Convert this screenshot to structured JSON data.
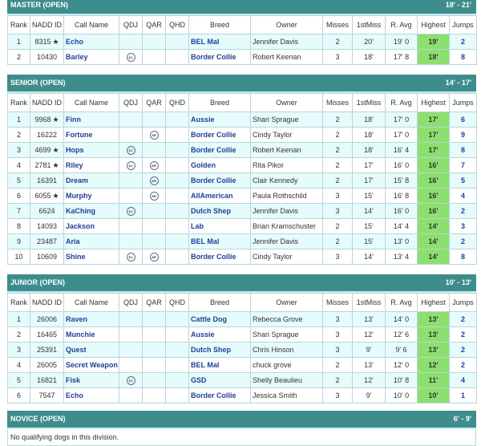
{
  "columns": [
    "Rank",
    "NADD ID",
    "Call Name",
    "QDJ",
    "QAR",
    "QHD",
    "Breed",
    "Owner",
    "Misses",
    "1stMiss",
    "R. Avg",
    "Highest",
    "Jumps"
  ],
  "badges": {
    "qdj": "DJ",
    "qar": "AR"
  },
  "sections": [
    {
      "title": "MASTER (OPEN)",
      "range": "18' - 21'",
      "rows": [
        {
          "rank": "1",
          "id": "8315",
          "star": true,
          "name": "Echo",
          "qdj": false,
          "qar": false,
          "breed": "BEL Mal",
          "owner": "Jennifer Davis",
          "misses": "2",
          "first": "20'",
          "avg": "19' 0",
          "high": "19'",
          "jumps": "2"
        },
        {
          "rank": "2",
          "id": "10430",
          "star": false,
          "name": "Barley",
          "qdj": true,
          "qar": false,
          "breed": "Border Collie",
          "owner": "Robert Keenan",
          "misses": "3",
          "first": "18'",
          "avg": "17' 8",
          "high": "18'",
          "jumps": "8"
        }
      ]
    },
    {
      "title": "SENIOR (OPEN)",
      "range": "14' - 17'",
      "rows": [
        {
          "rank": "1",
          "id": "9968",
          "star": true,
          "name": "Finn",
          "qdj": false,
          "qar": false,
          "breed": "Aussie",
          "owner": "Shari Sprague",
          "misses": "2",
          "first": "18'",
          "avg": "17' 0",
          "high": "17'",
          "jumps": "6"
        },
        {
          "rank": "2",
          "id": "16222",
          "star": false,
          "name": "Fortune",
          "qdj": false,
          "qar": true,
          "breed": "Border Collie",
          "owner": "Cindy Taylor",
          "misses": "2",
          "first": "18'",
          "avg": "17' 0",
          "high": "17'",
          "jumps": "9"
        },
        {
          "rank": "3",
          "id": "4699",
          "star": true,
          "name": "Hops",
          "qdj": true,
          "qar": false,
          "breed": "Border Collie",
          "owner": "Robert Keenan",
          "misses": "2",
          "first": "18'",
          "avg": "16' 4",
          "high": "17'",
          "jumps": "8"
        },
        {
          "rank": "4",
          "id": "2781",
          "star": true,
          "name": "Riley",
          "qdj": true,
          "qar": true,
          "breed": "Golden",
          "owner": "Rita Pikor",
          "misses": "2",
          "first": "17'",
          "avg": "16' 0",
          "high": "16'",
          "jumps": "7"
        },
        {
          "rank": "5",
          "id": "16391",
          "star": false,
          "name": "Dream",
          "qdj": false,
          "qar": true,
          "breed": "Border Collie",
          "owner": "Clair Kennedy",
          "misses": "2",
          "first": "17'",
          "avg": "15' 8",
          "high": "16'",
          "jumps": "5"
        },
        {
          "rank": "6",
          "id": "6055",
          "star": true,
          "name": "Murphy",
          "qdj": false,
          "qar": true,
          "breed": "AllAmerican",
          "owner": "Paula Rothschild",
          "misses": "3",
          "first": "15'",
          "avg": "16' 8",
          "high": "16'",
          "jumps": "4"
        },
        {
          "rank": "7",
          "id": "6624",
          "star": false,
          "name": "KaChing",
          "qdj": true,
          "qar": false,
          "breed": "Dutch Shep",
          "owner": "Jennifer Davis",
          "misses": "3",
          "first": "14'",
          "avg": "16' 0",
          "high": "16'",
          "jumps": "2"
        },
        {
          "rank": "8",
          "id": "14093",
          "star": false,
          "name": "Jackson",
          "qdj": false,
          "qar": false,
          "breed": "Lab",
          "owner": "Brian Kramschuster",
          "misses": "2",
          "first": "15'",
          "avg": "14' 4",
          "high": "14'",
          "jumps": "3"
        },
        {
          "rank": "9",
          "id": "23487",
          "star": false,
          "name": "Aria",
          "qdj": false,
          "qar": false,
          "breed": "BEL Mal",
          "owner": "Jennifer Davis",
          "misses": "2",
          "first": "15'",
          "avg": "13' 0",
          "high": "14'",
          "jumps": "2"
        },
        {
          "rank": "10",
          "id": "10609",
          "star": false,
          "name": "Shine",
          "qdj": true,
          "qar": true,
          "breed": "Border Collie",
          "owner": "Cindy Taylor",
          "misses": "3",
          "first": "14'",
          "avg": "13' 4",
          "high": "14'",
          "jumps": "8"
        }
      ]
    },
    {
      "title": "JUNIOR (OPEN)",
      "range": "10' - 13'",
      "rows": [
        {
          "rank": "1",
          "id": "26006",
          "star": false,
          "name": "Raven",
          "qdj": false,
          "qar": false,
          "breed": "Cattle Dog",
          "owner": "Rebecca Grove",
          "misses": "3",
          "first": "13'",
          "avg": "14' 0",
          "high": "13'",
          "jumps": "2"
        },
        {
          "rank": "2",
          "id": "16465",
          "star": false,
          "name": "Munchie",
          "qdj": false,
          "qar": false,
          "breed": "Aussie",
          "owner": "Shari Sprague",
          "misses": "3",
          "first": "12'",
          "avg": "12' 6",
          "high": "13'",
          "jumps": "2"
        },
        {
          "rank": "3",
          "id": "25391",
          "star": false,
          "name": "Quest",
          "qdj": false,
          "qar": false,
          "breed": "Dutch Shep",
          "owner": "Chris Hinson",
          "misses": "3",
          "first": "9'",
          "avg": "9' 6",
          "high": "13'",
          "jumps": "2"
        },
        {
          "rank": "4",
          "id": "26005",
          "star": false,
          "name": "Secret Weapon",
          "qdj": false,
          "qar": false,
          "breed": "BEL Mal",
          "owner": "chuck grove",
          "misses": "2",
          "first": "13'",
          "avg": "12' 0",
          "high": "12'",
          "jumps": "2"
        },
        {
          "rank": "5",
          "id": "16821",
          "star": false,
          "name": "Fisk",
          "qdj": true,
          "qar": false,
          "breed": "GSD",
          "owner": "Shelly Beaulieu",
          "misses": "2",
          "first": "12'",
          "avg": "10' 8",
          "high": "11'",
          "jumps": "4"
        },
        {
          "rank": "6",
          "id": "7547",
          "star": false,
          "name": "Echo",
          "qdj": false,
          "qar": false,
          "breed": "Border Collie",
          "owner": "Jessica Smith",
          "misses": "3",
          "first": "9'",
          "avg": "10' 0",
          "high": "10'",
          "jumps": "1"
        }
      ]
    }
  ],
  "novice": {
    "title": "NOVICE (OPEN)",
    "range": "6' - 9'",
    "note": "No qualifying dogs in this division."
  }
}
